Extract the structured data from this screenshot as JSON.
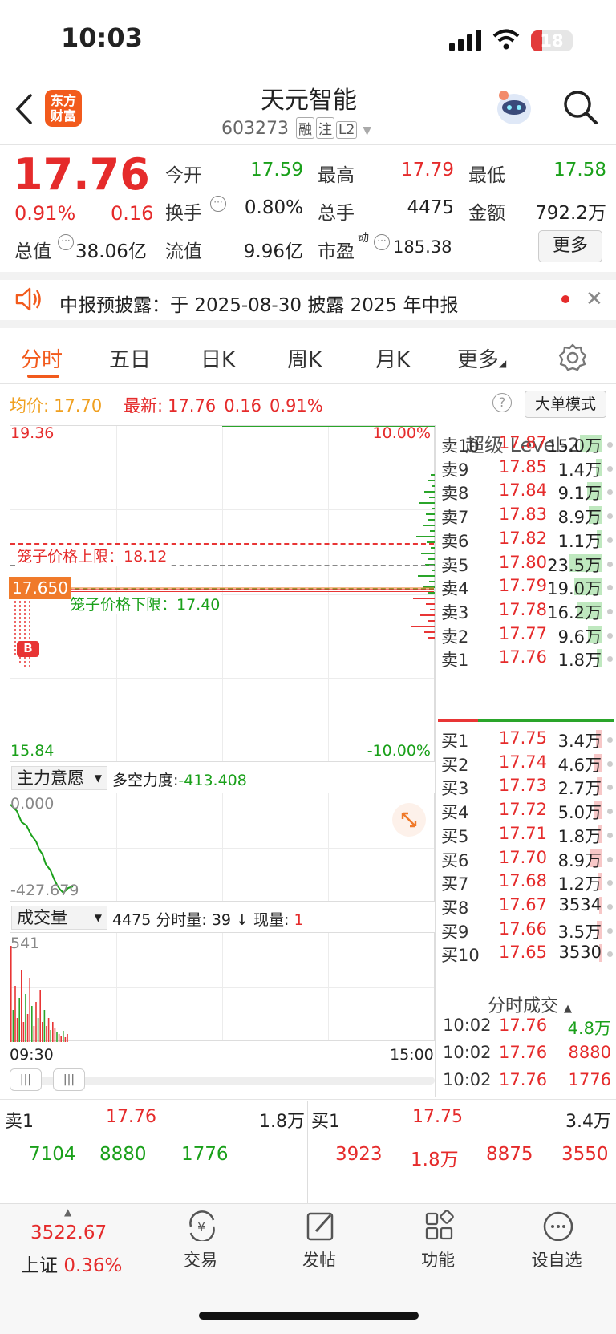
{
  "status_bar": {
    "time": "10:03",
    "battery": "18"
  },
  "header": {
    "logo": "东方\n财富",
    "title": "天元智能",
    "code": "603273",
    "tags": [
      "融",
      "注",
      "L2"
    ]
  },
  "quote": {
    "price": "17.76",
    "change_pct": "0.91%",
    "change": "0.16",
    "rows": [
      [
        {
          "l": "今开",
          "v": "17.59",
          "c": "green"
        },
        {
          "l": "最高",
          "v": "17.79",
          "c": "red"
        },
        {
          "l": "最低",
          "v": "17.58",
          "c": "green"
        }
      ],
      [
        {
          "l": "换手",
          "v": "0.80%",
          "c": "dark"
        },
        {
          "l": "总手",
          "v": "4475",
          "c": "dark"
        },
        {
          "l": "金额",
          "v": "792.2万",
          "c": "dark"
        }
      ]
    ],
    "total_value_label": "总值",
    "total_value": "38.06亿",
    "float_label": "流值",
    "float_value": "9.96亿",
    "pe_label": "市盈",
    "pe_sup": "动",
    "pe_value": "185.38",
    "more": "更多"
  },
  "notice": {
    "text": "中报预披露：于 2025-08-30 披露 2025 年中报"
  },
  "tabs": [
    "分时",
    "五日",
    "日K",
    "周K",
    "月K",
    "更多"
  ],
  "info_bar": {
    "avg_label": "均价:",
    "avg": "17.70",
    "last_label": "最新:",
    "last": "17.76",
    "chg": "0.16",
    "pct": "0.91%",
    "mode": "大单模式"
  },
  "chart": {
    "y_high": "19.36",
    "y_low": "15.84",
    "pct_high": "10.00%",
    "pct_low": "-10.00%",
    "upper_limit": "笼子价格上限：18.12",
    "lower_limit": "笼子价格下限：17.40",
    "cursor_price": "17.650",
    "b_marker": "B",
    "x_start": "09:30",
    "x_end": "15:00"
  },
  "sub1": {
    "selector": "主力意愿",
    "label": "多空力度:",
    "value": "-413.408",
    "top": "0.000",
    "bottom": "-427.679"
  },
  "sub2": {
    "selector": "成交量",
    "summary": "4475 分时量: 39 ↓ 现量: ",
    "now": "1",
    "max": "541"
  },
  "level2": {
    "title": "超级 Level-2",
    "asks": [
      {
        "n": "卖10",
        "p": "17.87",
        "v": "15.0万",
        "bar": 0.3
      },
      {
        "n": "卖9",
        "p": "17.85",
        "v": "1.4万",
        "bar": 0.08
      },
      {
        "n": "卖8",
        "p": "17.84",
        "v": "9.1万",
        "bar": 0.2
      },
      {
        "n": "卖7",
        "p": "17.83",
        "v": "8.9万",
        "bar": 0.18
      },
      {
        "n": "卖6",
        "p": "17.82",
        "v": "1.1万",
        "bar": 0.07
      },
      {
        "n": "卖5",
        "p": "17.80",
        "v": "23.5万",
        "bar": 0.45
      },
      {
        "n": "卖4",
        "p": "17.79",
        "v": "19.0万",
        "bar": 0.38
      },
      {
        "n": "卖3",
        "p": "17.78",
        "v": "16.2万",
        "bar": 0.33
      },
      {
        "n": "卖2",
        "p": "17.77",
        "v": "9.6万",
        "bar": 0.19
      },
      {
        "n": "卖1",
        "p": "17.76",
        "v": "1.8万",
        "bar": 0.07
      }
    ],
    "bids": [
      {
        "n": "买1",
        "p": "17.75",
        "v": "3.4万",
        "bar": 0.08
      },
      {
        "n": "买2",
        "p": "17.74",
        "v": "4.6万",
        "bar": 0.1
      },
      {
        "n": "买3",
        "p": "17.73",
        "v": "2.7万",
        "bar": 0.07
      },
      {
        "n": "买4",
        "p": "17.72",
        "v": "5.0万",
        "bar": 0.1
      },
      {
        "n": "买5",
        "p": "17.71",
        "v": "1.8万",
        "bar": 0.06
      },
      {
        "n": "买6",
        "p": "17.70",
        "v": "8.9万",
        "bar": 0.17
      },
      {
        "n": "买7",
        "p": "17.68",
        "v": "1.2万",
        "bar": 0.05
      },
      {
        "n": "买8",
        "p": "17.67",
        "v": "3534",
        "bar": 0.03
      },
      {
        "n": "买9",
        "p": "17.66",
        "v": "3.5万",
        "bar": 0.07
      },
      {
        "n": "买10",
        "p": "17.65",
        "v": "3530",
        "bar": 0.03
      }
    ],
    "trades_title": "分时成交",
    "trades": [
      {
        "t": "10:02",
        "p": "17.76",
        "v": "4.8万",
        "c": "green"
      },
      {
        "t": "10:02",
        "p": "17.76",
        "v": "8880",
        "c": "red"
      },
      {
        "t": "10:02",
        "p": "17.76",
        "v": "1776",
        "c": "red"
      }
    ]
  },
  "bottom_quote": {
    "ask_label": "卖1",
    "ask_price": "17.76",
    "ask_vol": "1.8万",
    "bid_label": "买1",
    "bid_price": "17.75",
    "bid_vol": "3.4万",
    "ask_queue": [
      "7104",
      "8880",
      "1776"
    ],
    "bid_queue": [
      "3923",
      "1.8万",
      "8875",
      "3550"
    ]
  },
  "bottom_nav": {
    "index_value": "3522.67",
    "index_name": "上证",
    "index_pct": "0.36%",
    "items": [
      "交易",
      "发帖",
      "功能",
      "设自选"
    ]
  }
}
